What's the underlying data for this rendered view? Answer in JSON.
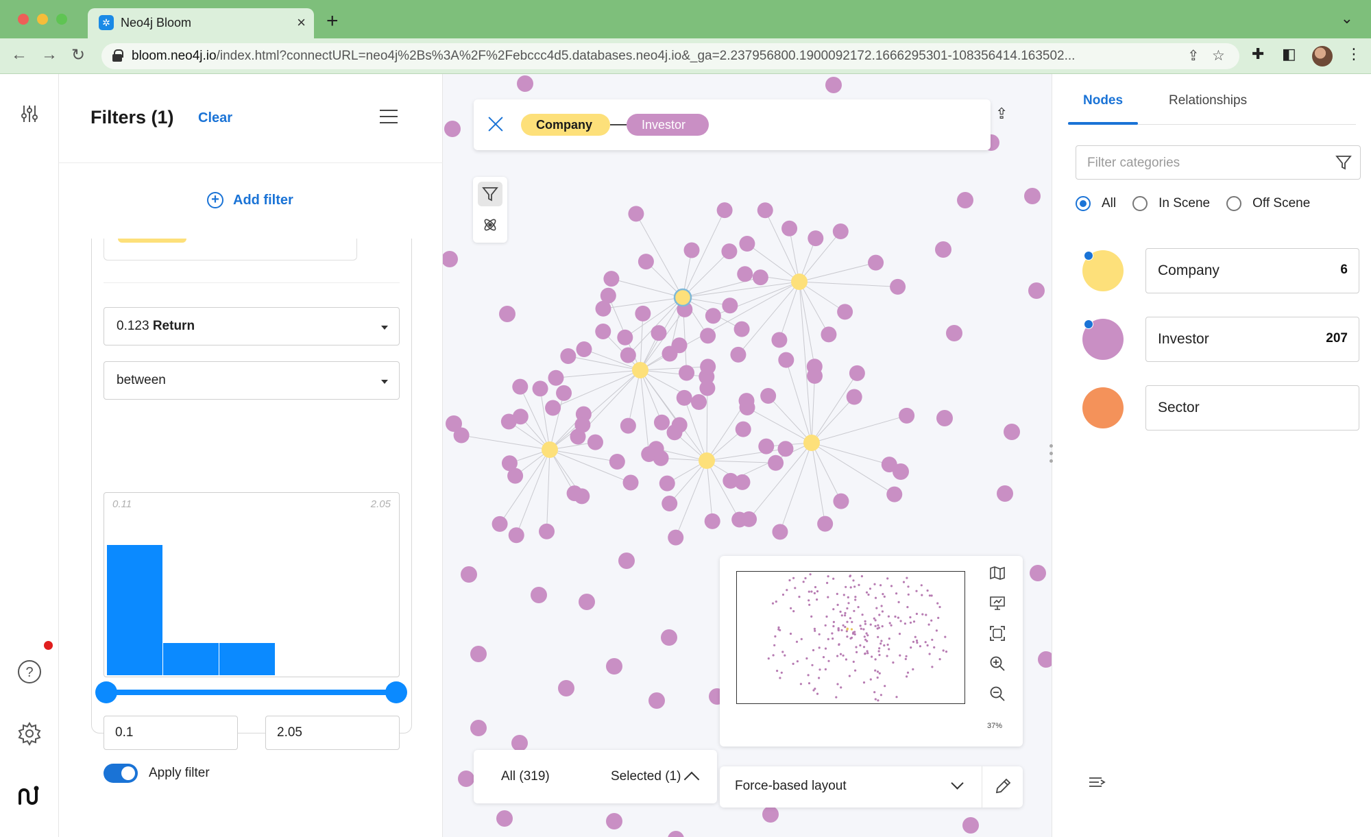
{
  "browser": {
    "tab_title": "Neo4j Bloom",
    "url_host": "bloom.neo4j.io",
    "url_rest": "/index.html?connectURL=neo4j%2Bs%3A%2F%2Febccc4d5.databases.neo4j.io&_ga=2.237956800.1900092172.1666295301-108356414.163502..."
  },
  "filters": {
    "title": "Filters (1)",
    "clear_label": "Clear",
    "add_filter_label": "Add filter",
    "property_value": "0.123",
    "property_name": "Return",
    "operator": "between",
    "histogram": {
      "min_label": "0.11",
      "max_label": "2.05",
      "bin_heights": [
        0.84,
        0.21,
        0.21
      ]
    },
    "range_min": "0.1",
    "range_max": "2.05",
    "apply_label": "Apply filter",
    "apply_on": true
  },
  "search": {
    "node_label_start": "Company",
    "node_label_end": "Investor"
  },
  "graph": {
    "zoom_label": "37%",
    "count_all": "All (319)",
    "count_selected": "Selected (1)",
    "layout_label": "Force-based layout",
    "company_color": "#fde07a",
    "investor_color": "#c98fc4",
    "sector_color": "#f4925a"
  },
  "legend": {
    "tab_nodes": "Nodes",
    "tab_relationships": "Relationships",
    "filter_placeholder": "Filter categories",
    "radio_all": "All",
    "radio_in_scene": "In Scene",
    "radio_off_scene": "Off Scene",
    "categories": [
      {
        "name": "Company",
        "count": "6",
        "color": "#fde07a"
      },
      {
        "name": "Investor",
        "count": "207",
        "color": "#c98fc4"
      },
      {
        "name": "Sector",
        "count": "",
        "color": "#f4925a"
      }
    ]
  }
}
